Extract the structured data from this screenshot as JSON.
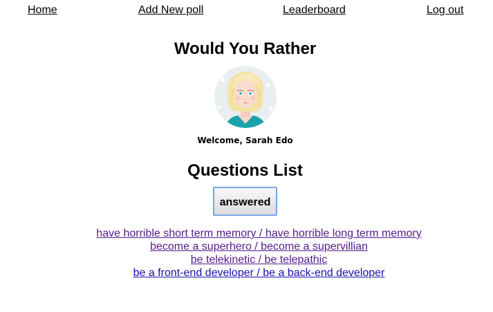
{
  "nav": {
    "home_label": "Home",
    "add_poll_label": "Add New poll",
    "leaderboard_label": "Leaderboard",
    "logout_label": "Log out"
  },
  "app_title": "Would You Rather",
  "user": {
    "avatar": "avatar-woman-blonde",
    "welcome_text": "Welcome, Sarah Edo"
  },
  "questions_list": {
    "title": "Questions List",
    "toggle_label": "answered",
    "items": [
      {
        "text": "have horrible short term memory / have horrible long term memory",
        "visited": true
      },
      {
        "text": "become a superhero / become a supervillian",
        "visited": true
      },
      {
        "text": "be telekinetic / be telepathic",
        "visited": true
      },
      {
        "text": "be a front-end developer / be a back-end developer",
        "visited": false
      }
    ]
  },
  "colors": {
    "visited_link": "#551a8b",
    "unvisited_link": "#1a0dab",
    "button_border": "#7aa4e6"
  }
}
